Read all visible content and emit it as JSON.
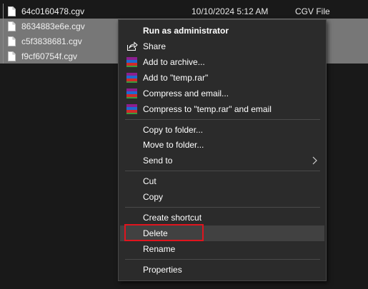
{
  "files": [
    {
      "name": "64c0160478.cgv",
      "date": "10/10/2024 5:12 AM",
      "type": "CGV File"
    },
    {
      "name": "8634883e6e.cgv",
      "date": "",
      "type": ""
    },
    {
      "name": "c5f3838681.cgv",
      "date": "",
      "type": ""
    },
    {
      "name": "f9cf60754f.cgv",
      "date": "",
      "type": ""
    }
  ],
  "menu": {
    "run_as_admin": "Run as administrator",
    "share": "Share",
    "add_to_archive": "Add to archive...",
    "add_to_temp": "Add to \"temp.rar\"",
    "compress_email": "Compress and email...",
    "compress_temp_email": "Compress to \"temp.rar\" and email",
    "copy_to_folder": "Copy to folder...",
    "move_to_folder": "Move to folder...",
    "send_to": "Send to",
    "cut": "Cut",
    "copy": "Copy",
    "create_shortcut": "Create shortcut",
    "delete": "Delete",
    "rename": "Rename",
    "properties": "Properties"
  },
  "colors": {
    "highlight_border": "#e0141e",
    "menu_bg": "#2b2b2b",
    "selected_row": "#777777"
  },
  "icons": {
    "file": "file-icon",
    "share": "share-icon",
    "winrar": "winrar-icon",
    "submenu": "chevron-right-icon"
  }
}
